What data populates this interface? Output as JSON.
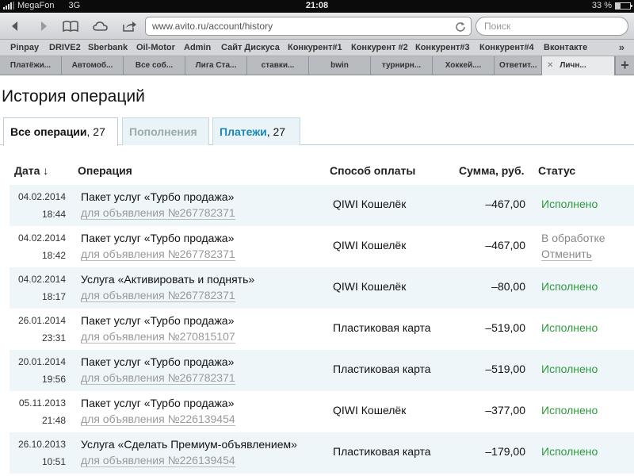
{
  "statusbar": {
    "carrier": "MegaFon",
    "network": "3G",
    "time": "21:08",
    "battery": "33 %",
    "battery_level": 0.33
  },
  "toolbar": {
    "url": "www.avito.ru/account/history",
    "search_placeholder": "Поиск"
  },
  "bookmarks": [
    "Pinpay",
    "DRIVE2",
    "Sberbank",
    "Oil-Motor",
    "Admin",
    "Сайт Дискуса",
    "Конкурент#1",
    "Конкурент #2",
    "Конкурент#3",
    "Конкурент#4",
    "Вконтакте"
  ],
  "bookmarks_more": "»",
  "browser_tabs": [
    "Платёжи...",
    "Автомоб...",
    "Все соб...",
    "Лига Ста...",
    "ставки...",
    "bwin",
    "турнирн...",
    "Хоккей....",
    "Ответит...",
    "Личн..."
  ],
  "add_tab": "+",
  "page": {
    "title": "История операций",
    "tabs": [
      {
        "label": "Все операции",
        "count": ", 27"
      },
      {
        "label": "Пополнения"
      },
      {
        "label": "Платежи",
        "count": ", 27"
      }
    ],
    "headers": {
      "date": "Дата ↓",
      "operation": "Операция",
      "payment": "Способ оплаты",
      "sum": "Сумма, руб.",
      "status": "Статус"
    },
    "rows": [
      {
        "date": "04.02.2014",
        "time": "18:44",
        "op": "Пакет услуг «Турбо продажа»",
        "link": "для объявления №267782371",
        "pay": "QIWI Кошелёк",
        "sum": "–467,00",
        "status": "Исполнено"
      },
      {
        "date": "04.02.2014",
        "time": "18:42",
        "op": "Пакет услуг «Турбо продажа»",
        "link": "для объявления №267782371",
        "pay": "QIWI Кошелёк",
        "sum": "–467,00",
        "status": "В обработке",
        "cancel": "Отменить"
      },
      {
        "date": "04.02.2014",
        "time": "18:17",
        "op": "Услуга «Активировать и поднять»",
        "link": "для объявления №267782371",
        "pay": "QIWI Кошелёк",
        "sum": "–80,00",
        "status": "Исполнено"
      },
      {
        "date": "26.01.2014",
        "time": "23:31",
        "op": "Пакет услуг «Турбо продажа»",
        "link": "для объявления №270815107",
        "pay": "Пластиковая карта",
        "sum": "–519,00",
        "status": "Исполнено"
      },
      {
        "date": "20.01.2014",
        "time": "19:56",
        "op": "Пакет услуг «Турбо продажа»",
        "link": "для объявления №267782371",
        "pay": "Пластиковая карта",
        "sum": "–519,00",
        "status": "Исполнено"
      },
      {
        "date": "05.11.2013",
        "time": "21:48",
        "op": "Пакет услуг «Турбо продажа»",
        "link": "для объявления №226139454",
        "pay": "QIWI Кошелёк",
        "sum": "–377,00",
        "status": "Исполнено"
      },
      {
        "date": "26.10.2013",
        "time": "10:51",
        "op": "Услуга «Сделать Премиум-объявлением»",
        "link": "для объявления №226139454",
        "pay": "Пластиковая карта",
        "sum": "–179,00",
        "status": "Исполнено"
      }
    ]
  },
  "colors": {
    "accent": "#1a87b5",
    "success": "#2e9a3c",
    "muted": "#888888",
    "row_shade": "#eef6fa"
  }
}
